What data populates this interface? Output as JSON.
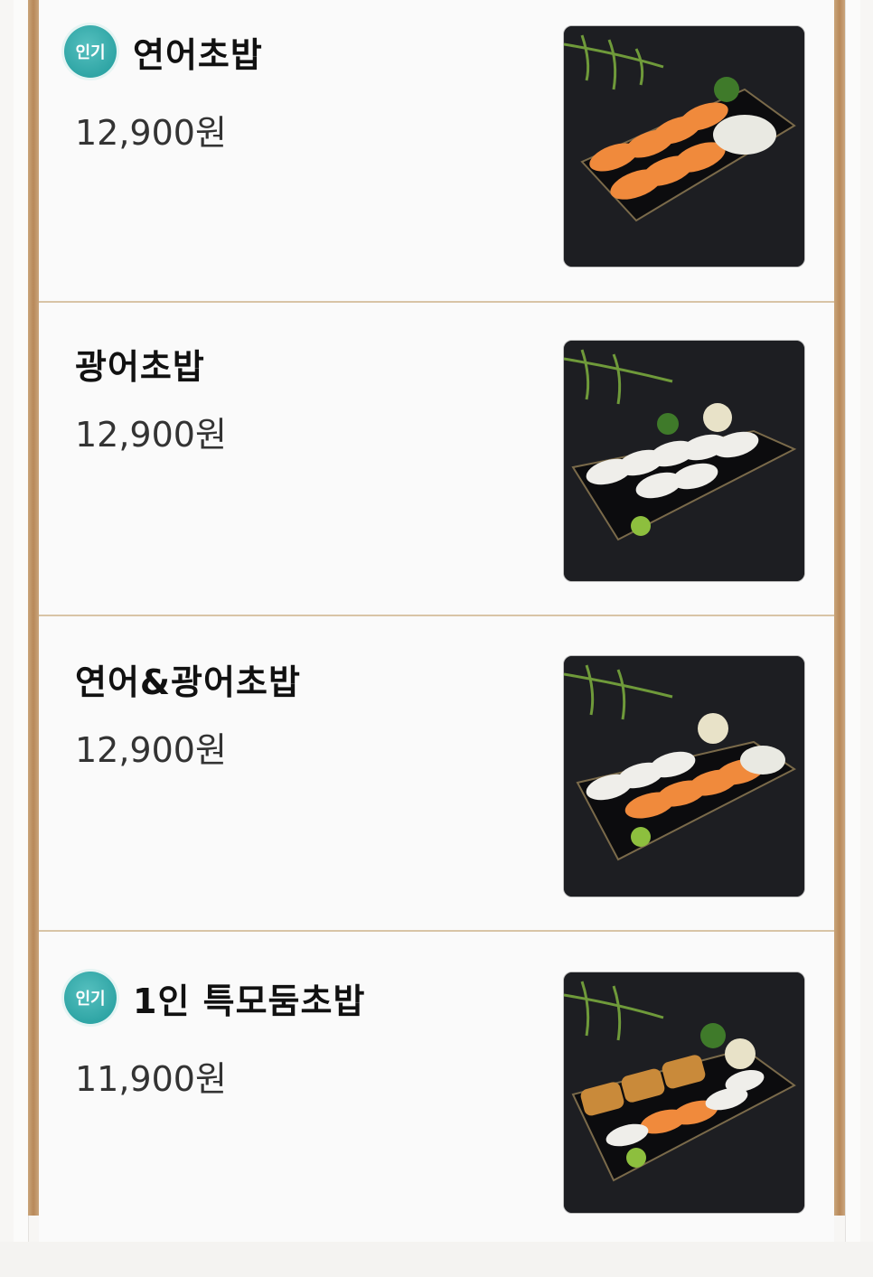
{
  "badge_label": "인기",
  "items": [
    {
      "name": "연어초밥",
      "price": "12,900원",
      "popular": true
    },
    {
      "name": "광어초밥",
      "price": "12,900원",
      "popular": false
    },
    {
      "name": "연어&광어초밥",
      "price": "12,900원",
      "popular": false
    },
    {
      "name": "1인 특모둠초밥",
      "price": "11,900원",
      "popular": true
    }
  ],
  "colors": {
    "badge": "#2fa5a5",
    "frame": "#b8895a",
    "divider": "#d8c4a6"
  }
}
